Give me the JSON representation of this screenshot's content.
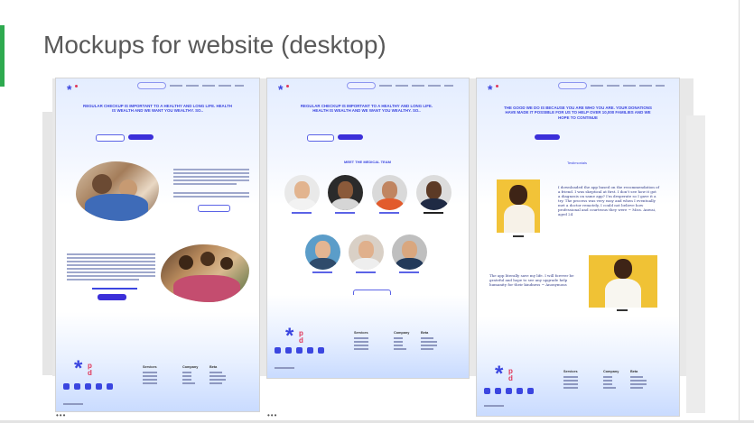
{
  "slide": {
    "title": "Mockups for website (desktop)",
    "accent_color": "#2eaa4f"
  },
  "mockups": [
    {
      "name": "home",
      "headline": "REGULAR CHECKUP IS IMPORTANT TO A HEALTHY AND LONG LIFE. HEALTH IS WEALTH AND WE WANT YOU WEALTHY. SO..",
      "cta_outline": "Schedule Meeting",
      "cta_fill": "Donate",
      "secondary_button": "Donate",
      "footer_columns": [
        "Services",
        "Company",
        "Beta"
      ]
    },
    {
      "name": "team",
      "headline": "REGULAR CHECKUP IS IMPORTANT TO A HEALTHY AND LONG LIFE. HEALTH IS WEALTH AND WE WANT YOU WEALTHY. SO..",
      "section_title": "MEET THE MEDICAL TEAM",
      "cta_outline": "Volunteer with us",
      "footer_columns": [
        "Services",
        "Company",
        "Beta"
      ]
    },
    {
      "name": "testimonials",
      "headline": "THE GOOD WE DO IS BECAUSE YOU ARE WHO YOU ARE. YOUR DONATIONS HAVE MADE IT POSSIBLE FOR US TO HELP OVER 10,000 FAMILIES AND WE HOPE TO CONTINUE",
      "section_title": "Testimonials",
      "quote_1": "I downloaded the app based on the recommendation of a friend. I was skeptical at first. I don’t see how it got a diagnosis on same app? I’m desperate so I gave it a try. The process was very easy and when I eventually met a doctor remotely, I could not believe how professional and courteous they were ~ Miss. Anwai, aged 24",
      "quote_2": "The app literally save my life. I will forever be grateful and hope to see any upgrade help humanity for their kindness ~ Anonymous",
      "footer_columns": [
        "Services",
        "Company",
        "Beta"
      ]
    }
  ],
  "controls": {
    "more_label": "•••"
  }
}
